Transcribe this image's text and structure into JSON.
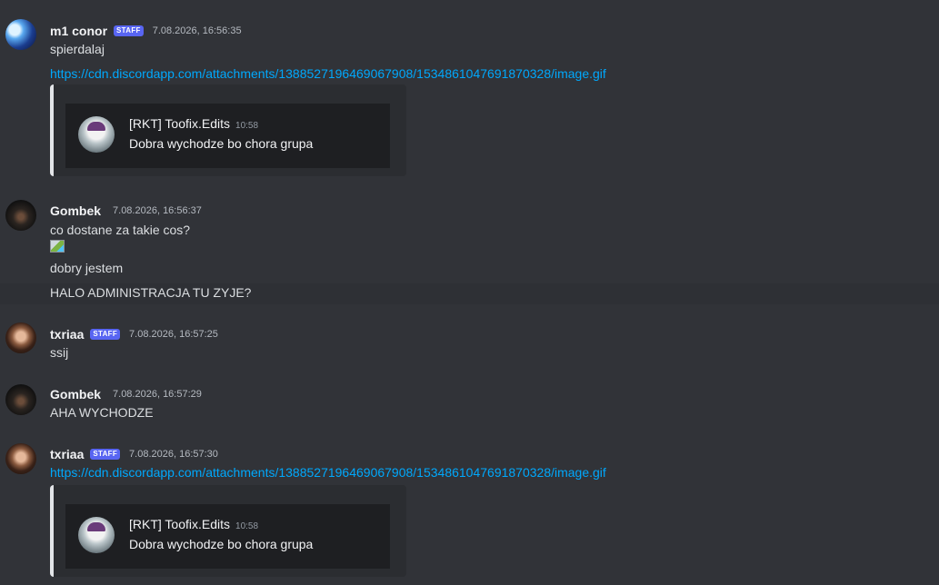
{
  "messages": [
    {
      "username": "m1 conor",
      "badge": "STAFF",
      "timestamp": "7.08.2026, 16:56:35",
      "lines": [
        "spierdalaj"
      ],
      "link": "https://cdn.discordapp.com/attachments/1388527196469067908/1534861047691870328/image.gif",
      "embed": {
        "quote_author": "[RKT] Toofix.Edits",
        "quote_time": "10:58",
        "quote_text": "Dobra wychodze bo chora grupa"
      }
    },
    {
      "username": "Gombek",
      "timestamp": "7.08.2026, 16:56:37",
      "lines": [
        "co dostane za takie cos?",
        "dobry jestem",
        "HALO ADMINISTRACJA TU ZYJE?"
      ]
    },
    {
      "username": "txriaa",
      "badge": "STAFF",
      "timestamp": "7.08.2026, 16:57:25",
      "lines": [
        "ssij"
      ]
    },
    {
      "username": "Gombek",
      "timestamp": "7.08.2026, 16:57:29",
      "lines": [
        "AHA WYCHODZE"
      ]
    },
    {
      "username": "txriaa",
      "badge": "STAFF",
      "timestamp": "7.08.2026, 16:57:30",
      "link": "https://cdn.discordapp.com/attachments/1388527196469067908/1534861047691870328/image.gif",
      "embed": {
        "quote_author": "[RKT] Toofix.Edits",
        "quote_time": "10:58",
        "quote_text": "Dobra wychodze bo chora grupa"
      }
    }
  ]
}
